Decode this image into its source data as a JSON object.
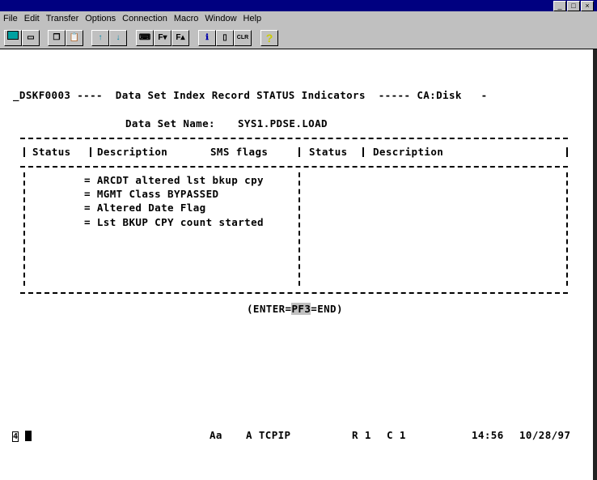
{
  "window": {
    "buttons": [
      "_",
      "□",
      "×"
    ]
  },
  "menu": [
    "File",
    "Edit",
    "Transfer",
    "Options",
    "Connection",
    "Macro",
    "Window",
    "Help"
  ],
  "toolbar": [
    {
      "icon": "display-icon"
    },
    {
      "icon": "print-icon"
    },
    {
      "icon": "copy-icon"
    },
    {
      "icon": "paste-icon"
    },
    {
      "icon": "send-icon"
    },
    {
      "icon": "receive-icon"
    },
    {
      "icon": "keyboard-icon"
    },
    {
      "icon": "font-down-icon",
      "label": "F▾"
    },
    {
      "icon": "font-up-icon",
      "label": "F▴"
    },
    {
      "icon": "info-icon"
    },
    {
      "icon": "macro-icon"
    },
    {
      "icon": "clear-icon",
      "label": "CLR"
    },
    {
      "icon": "help-icon",
      "label": "?"
    }
  ],
  "terminal": {
    "header": "_DSKF0003 ----  Data Set Index Record STATUS Indicators  ----- CA:Disk   -",
    "dataset_label": "Data Set Name:",
    "dataset_name": "SYS1.PDSE.LOAD",
    "columns": [
      "Status",
      "Description",
      "SMS flags",
      "Status",
      "Description"
    ],
    "rows": [
      "= ARCDT altered lst bkup cpy",
      "= MGMT Class BYPASSED",
      "= Altered Date Flag",
      "= Lst BKUP CPY count started"
    ],
    "footer_pre": "(ENTER=",
    "footer_key": "PF3",
    "footer_post": "=END)"
  },
  "status": {
    "session": "4",
    "mode": "Aa",
    "conn": "A TCPIP",
    "row": "R 1",
    "col": "C 1",
    "time": "14:56",
    "date": "10/28/97"
  }
}
